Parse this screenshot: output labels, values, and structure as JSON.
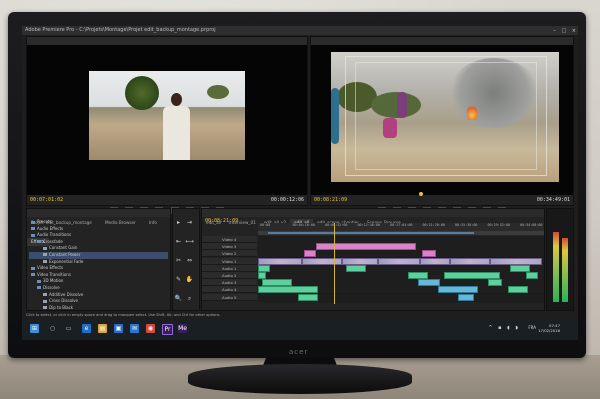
{
  "app": {
    "title": "Adobe Premiere Pro - C:\\Projets\\Montage\\Projet edit_backup_montage.prproj",
    "window_controls": [
      "–",
      "□",
      "×"
    ]
  },
  "source_monitor": {
    "tabs": [
      "Effect Controls",
      "Audio Mixer: edit_all",
      "Metadata",
      "Source: edit_all: centre_interview.mov: 00:00:09:19"
    ],
    "active_tab_index": 3,
    "timecode_in": "00:07:01:02",
    "timecode_dur": "00:00:12:06"
  },
  "program_monitor": {
    "tabs": [
      "Program: edit_all"
    ],
    "timecode_in": "00:08:21:09",
    "timecode_dur": "00:34:49:01"
  },
  "transport_buttons": [
    "{",
    "}",
    "|◀",
    "◀",
    "▶",
    "▶|",
    "⊕",
    "⊖",
    "⤢"
  ],
  "project_panel": {
    "tabs": [
      "Projet: edit_backup_montage",
      "Media Browser",
      "Info",
      "Effects"
    ],
    "active_tab_index": 3,
    "items": [
      {
        "label": "Presets",
        "kind": "folder",
        "depth": 0
      },
      {
        "label": "Audio Effects",
        "kind": "folder",
        "depth": 0
      },
      {
        "label": "Audio Transitions",
        "kind": "folder",
        "depth": 0
      },
      {
        "label": "Crossfade",
        "kind": "folder",
        "depth": 1
      },
      {
        "label": "Constant Gain",
        "kind": "fx",
        "depth": 2
      },
      {
        "label": "Constant Power",
        "kind": "fx",
        "depth": 2,
        "selected": true
      },
      {
        "label": "Exponential Fade",
        "kind": "fx",
        "depth": 2
      },
      {
        "label": "Video Effects",
        "kind": "folder",
        "depth": 0
      },
      {
        "label": "Video Transitions",
        "kind": "folder",
        "depth": 0
      },
      {
        "label": "3D Motion",
        "kind": "folder",
        "depth": 1
      },
      {
        "label": "Dissolve",
        "kind": "folder",
        "depth": 1
      },
      {
        "label": "Additive Dissolve",
        "kind": "fx",
        "depth": 2
      },
      {
        "label": "Cross Dissolve",
        "kind": "fx",
        "depth": 2
      },
      {
        "label": "Dip to Black",
        "kind": "fx",
        "depth": 2
      }
    ]
  },
  "tools": [
    "▸",
    "⇥",
    "⇤",
    "⟷",
    "✂",
    "⇔",
    "✎",
    "✋",
    "🔍",
    "⌕"
  ],
  "timeline": {
    "tabs": [
      "edit_all",
      "interview_01",
      "edit_all_v2",
      "edit_all",
      "edit_scene_chantier",
      "Scenes_Brousse"
    ],
    "active_tab_index": 3,
    "timecode": "00:08:21:09",
    "ruler_ticks": [
      "00:00",
      "00:04:16:00",
      "00:08:32:00",
      "00:12:48:00",
      "00:17:04:00",
      "00:21:20:00",
      "00:25:36:00",
      "00:29:52:00",
      "00:34:08:00"
    ],
    "tracks": [
      {
        "name": "Video 4"
      },
      {
        "name": "Video 3"
      },
      {
        "name": "Video 2"
      },
      {
        "name": "Video 1"
      },
      {
        "name": "Audio 1"
      },
      {
        "name": "Audio 2"
      },
      {
        "name": "Audio 3"
      },
      {
        "name": "Audio 4"
      },
      {
        "name": "Audio 5"
      }
    ]
  },
  "status_bar": "Click to select, or click in empty space and drag to marquee select. Use Shift, Alt, and Ctrl for other options.",
  "taskbar": {
    "start_icon": "windows-start-icon",
    "apps": [
      "search",
      "task-view",
      "edge",
      "explorer",
      "store",
      "mail",
      "chrome",
      "premiere",
      "media-encoder"
    ],
    "tray": "FRA",
    "time": "07:47",
    "date": "17/02/2016"
  },
  "monitor_brand": "acer",
  "colors": {
    "video_clip": "#a9a9c2",
    "title_clip": "#d983c8",
    "audio_clip": "#5fcf9e",
    "timecode": "#e8c23a",
    "accent": "#3f7fc0"
  }
}
